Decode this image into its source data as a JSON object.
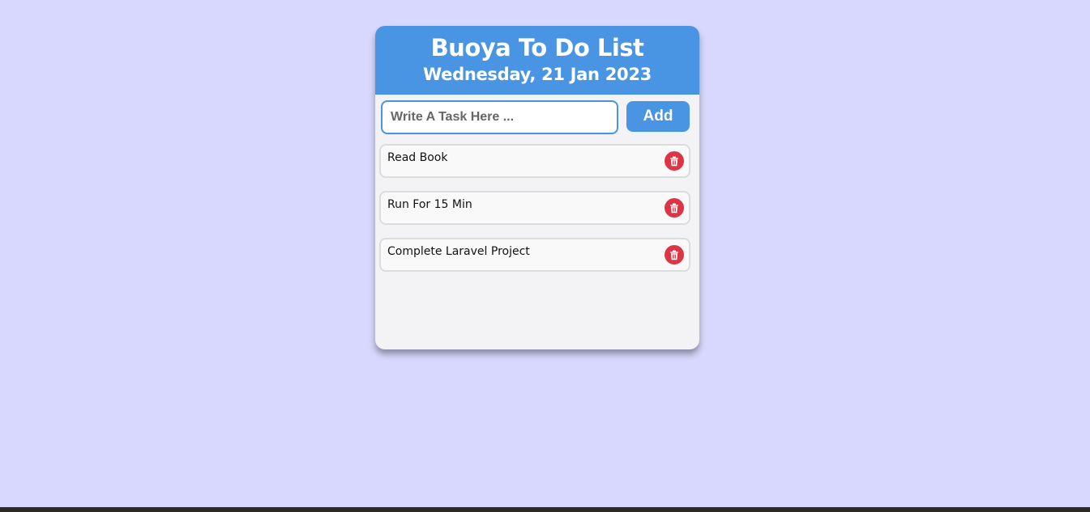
{
  "app": {
    "title": "Buoya To Do List",
    "date": "Wednesday, 21 Jan 2023"
  },
  "input": {
    "placeholder": "Write A Task Here ...",
    "value": ""
  },
  "add_button": {
    "label": "Add"
  },
  "tasks": [
    {
      "label": "Read Book"
    },
    {
      "label": "Run For 15 Min"
    },
    {
      "label": "Complete Laravel Project"
    }
  ],
  "icons": {
    "delete": "trash-icon"
  },
  "colors": {
    "background": "#d8d8fe",
    "accent": "#4a94e4",
    "danger": "#dc3545",
    "card": "#f3f3f6"
  }
}
